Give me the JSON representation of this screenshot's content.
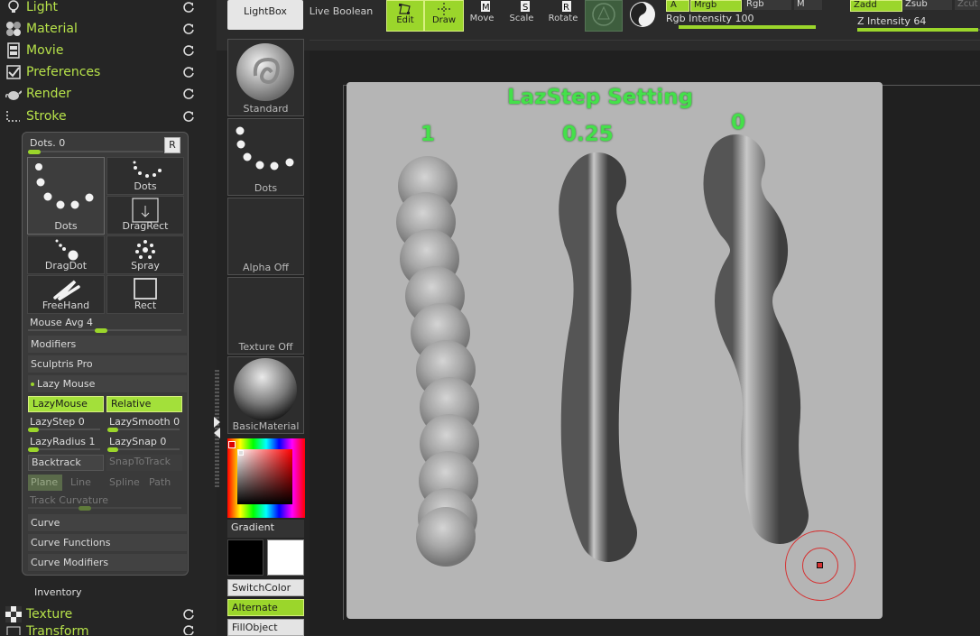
{
  "left_menu": {
    "items": [
      {
        "label": "Light",
        "icon": "bulb-icon"
      },
      {
        "label": "Material",
        "icon": "material-spheres-icon"
      },
      {
        "label": "Movie",
        "icon": "film-icon"
      },
      {
        "label": "Preferences",
        "icon": "checkbox-icon"
      },
      {
        "label": "Render",
        "icon": "teapot-icon"
      },
      {
        "label": "Stroke",
        "icon": "stroke-icon"
      }
    ],
    "bottom_items": [
      {
        "label": "Texture",
        "icon": "checker-icon"
      },
      {
        "label": "Transform",
        "icon": "transform-icon"
      }
    ],
    "inventory_label": "Inventory"
  },
  "stroke": {
    "dots_slider": {
      "label": "Dots. 0",
      "value": 0
    },
    "reset_label": "R",
    "tiles": [
      {
        "label": "Dots",
        "icon": "dots-curve-icon"
      },
      {
        "label": "Dots",
        "icon": "dots-small-icon"
      },
      {
        "label": "DragRect",
        "icon": "drag-rect-icon"
      },
      {
        "label": "DragDot",
        "icon": "drag-dot-icon"
      },
      {
        "label": "Spray",
        "icon": "spray-icon"
      },
      {
        "label": "FreeHand",
        "icon": "freehand-icon"
      },
      {
        "label": "Rect",
        "icon": "rect-icon"
      }
    ],
    "mouse_avg": {
      "label": "Mouse Avg 4",
      "value": 4
    },
    "sections": [
      "Modifiers",
      "Sculptris Pro",
      "Lazy Mouse"
    ],
    "lazymouse_btn": "LazyMouse",
    "relative_btn": "Relative",
    "lazystep": {
      "label": "LazyStep 0",
      "value": 0
    },
    "lazysmooth": {
      "label": "LazySmooth 0",
      "value": 0
    },
    "lazyradius": {
      "label": "LazyRadius 1",
      "value": 1
    },
    "lazysnap": {
      "label": "LazySnap 0",
      "value": 0
    },
    "backtrack": "Backtrack",
    "snaptotrack": "SnapToTrack",
    "modes": [
      "Plane",
      "Line",
      "Spline",
      "Path"
    ],
    "track_curvature": "Track Curvature",
    "curve_sections": [
      "Curve",
      "Curve Functions",
      "Curve Modifiers"
    ]
  },
  "mid_panel": {
    "brush_label": "Standard",
    "stroke_label": "Dots",
    "alpha_label": "Alpha Off",
    "texture_label": "Texture Off",
    "material_label": "BasicMaterial",
    "gradient_label": "Gradient",
    "switchcolor_label": "SwitchColor",
    "alternate_label": "Alternate",
    "fillobject_label": "FillObject"
  },
  "topbar": {
    "lightbox": "LightBox",
    "live_boolean": "Live Boolean",
    "edit": "Edit",
    "draw": "Draw",
    "move": "Move",
    "scale": "Scale",
    "rotate": "Rotate",
    "a_btn": "A",
    "mrgb": "Mrgb",
    "rgb": "Rgb",
    "m_btn": "M",
    "rgb_intensity": "Rgb Intensity 100",
    "zadd": "Zadd",
    "zsub": "Zsub",
    "zcut": "Zcut",
    "z_intensity": "Z Intensity 64"
  },
  "canvas": {
    "title": "LazStep Setting",
    "labels": [
      "1",
      "0.25",
      "0"
    ]
  },
  "colors": {
    "accent_green": "#a3e03a",
    "menu_green": "#b7e24a",
    "title_green": "#44e04a",
    "cursor_red": "#d63030"
  }
}
